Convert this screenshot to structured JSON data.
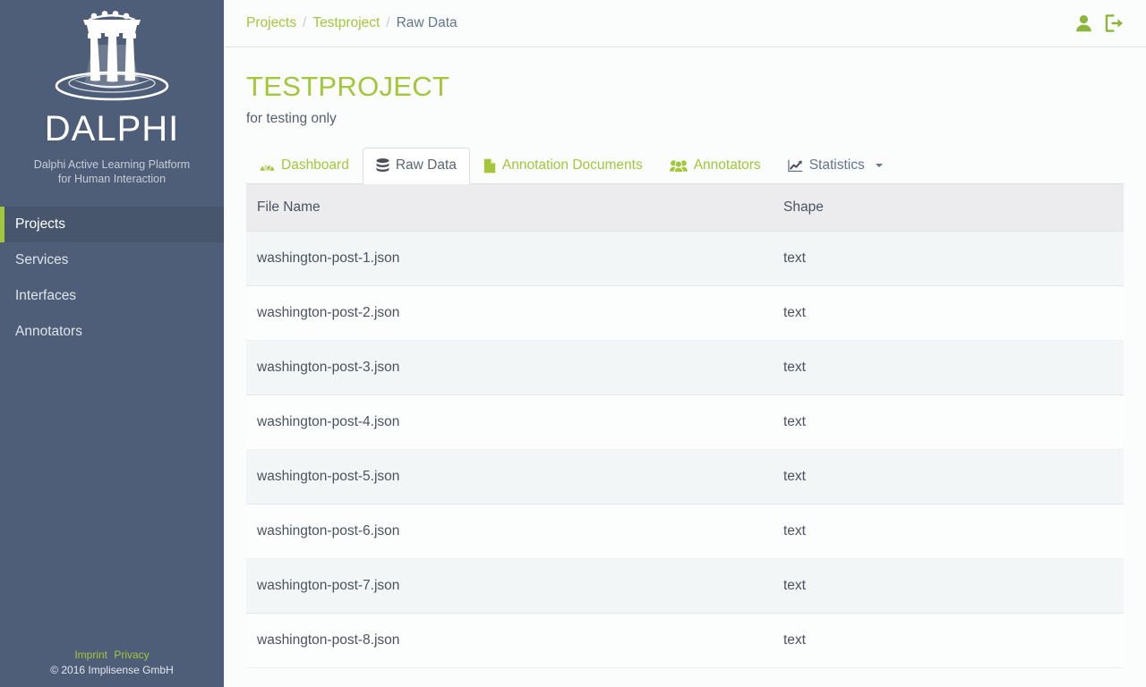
{
  "sidebar": {
    "logo_icon": "greek-temple-logo",
    "brand_name": "DALPHI",
    "tagline_line1": "Dalphi Active Learning Platform",
    "tagline_line2": "for Human Interaction",
    "items": [
      {
        "label": "Projects",
        "active": true
      },
      {
        "label": "Services",
        "active": false
      },
      {
        "label": "Interfaces",
        "active": false
      },
      {
        "label": "Annotators",
        "active": false
      }
    ],
    "footer": {
      "imprint_label": "Imprint",
      "privacy_label": "Privacy",
      "copyright": "© 2016 Implisense GmbH"
    },
    "accent_color": "#a4c63b",
    "background_color": "#4e5d78"
  },
  "topbar": {
    "breadcrumb": [
      {
        "label": "Projects",
        "link": true
      },
      {
        "label": "Testproject",
        "link": true
      },
      {
        "label": "Raw Data",
        "link": false
      }
    ],
    "separator": "/",
    "actions": [
      {
        "icon": "user-icon",
        "label": "Account"
      },
      {
        "icon": "sign-out-icon",
        "label": "Logout"
      }
    ]
  },
  "page": {
    "title": "TESTPROJECT",
    "subtitle": "for testing only",
    "title_color": "#a4c63b"
  },
  "tabs": [
    {
      "label": "Dashboard",
      "icon": "dashboard-icon",
      "active": false,
      "dropdown": false
    },
    {
      "label": "Raw Data",
      "icon": "database-icon",
      "active": true,
      "dropdown": false
    },
    {
      "label": "Annotation Documents",
      "icon": "file-icon",
      "active": false,
      "dropdown": false
    },
    {
      "label": "Annotators",
      "icon": "users-icon",
      "active": false,
      "dropdown": false
    },
    {
      "label": "Statistics",
      "icon": "line-chart-icon",
      "active": false,
      "dropdown": true
    }
  ],
  "table": {
    "columns": [
      "File Name",
      "Shape"
    ],
    "rows": [
      {
        "file_name": "washington-post-1.json",
        "shape": "text"
      },
      {
        "file_name": "washington-post-2.json",
        "shape": "text"
      },
      {
        "file_name": "washington-post-3.json",
        "shape": "text"
      },
      {
        "file_name": "washington-post-4.json",
        "shape": "text"
      },
      {
        "file_name": "washington-post-5.json",
        "shape": "text"
      },
      {
        "file_name": "washington-post-6.json",
        "shape": "text"
      },
      {
        "file_name": "washington-post-7.json",
        "shape": "text"
      },
      {
        "file_name": "washington-post-8.json",
        "shape": "text"
      }
    ]
  }
}
